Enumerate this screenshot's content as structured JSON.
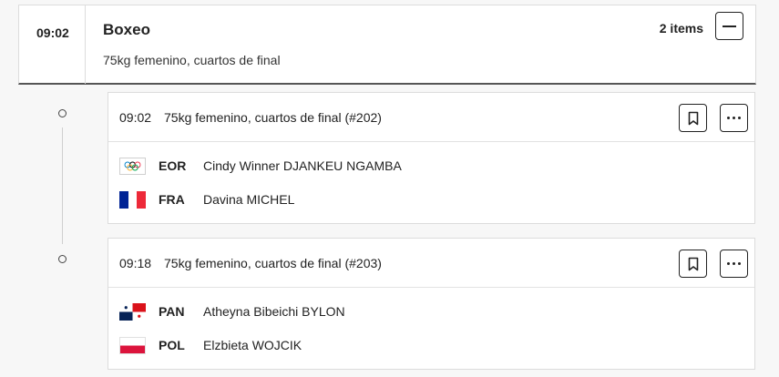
{
  "session": {
    "time": "09:02",
    "title": "Boxeo",
    "subtitle": "75kg femenino, cuartos de final",
    "items_count": "2 items"
  },
  "events": [
    {
      "time": "09:02",
      "description": "75kg femenino, cuartos de final (#202)",
      "competitors": [
        {
          "code": "EOR",
          "name": "Cindy Winner DJANKEU NGAMBA",
          "flag": "olympic-rings-icon"
        },
        {
          "code": "FRA",
          "name": "Davina MICHEL",
          "flag": "france-flag-icon"
        }
      ]
    },
    {
      "time": "09:18",
      "description": "75kg femenino, cuartos de final (#203)",
      "competitors": [
        {
          "code": "PAN",
          "name": "Atheyna Bibeichi BYLON",
          "flag": "panama-flag-icon"
        },
        {
          "code": "POL",
          "name": "Elzbieta WOJCIK",
          "flag": "poland-flag-icon"
        }
      ]
    }
  ],
  "icons": {
    "collapse": "minus-icon",
    "bookmark": "bookmark-icon",
    "more": "more-options-icon"
  },
  "colors": {
    "france_blue": "#002395",
    "france_red": "#ED2939",
    "panama_blue": "#072357",
    "panama_red": "#DA121A",
    "poland_red": "#DC143C"
  }
}
